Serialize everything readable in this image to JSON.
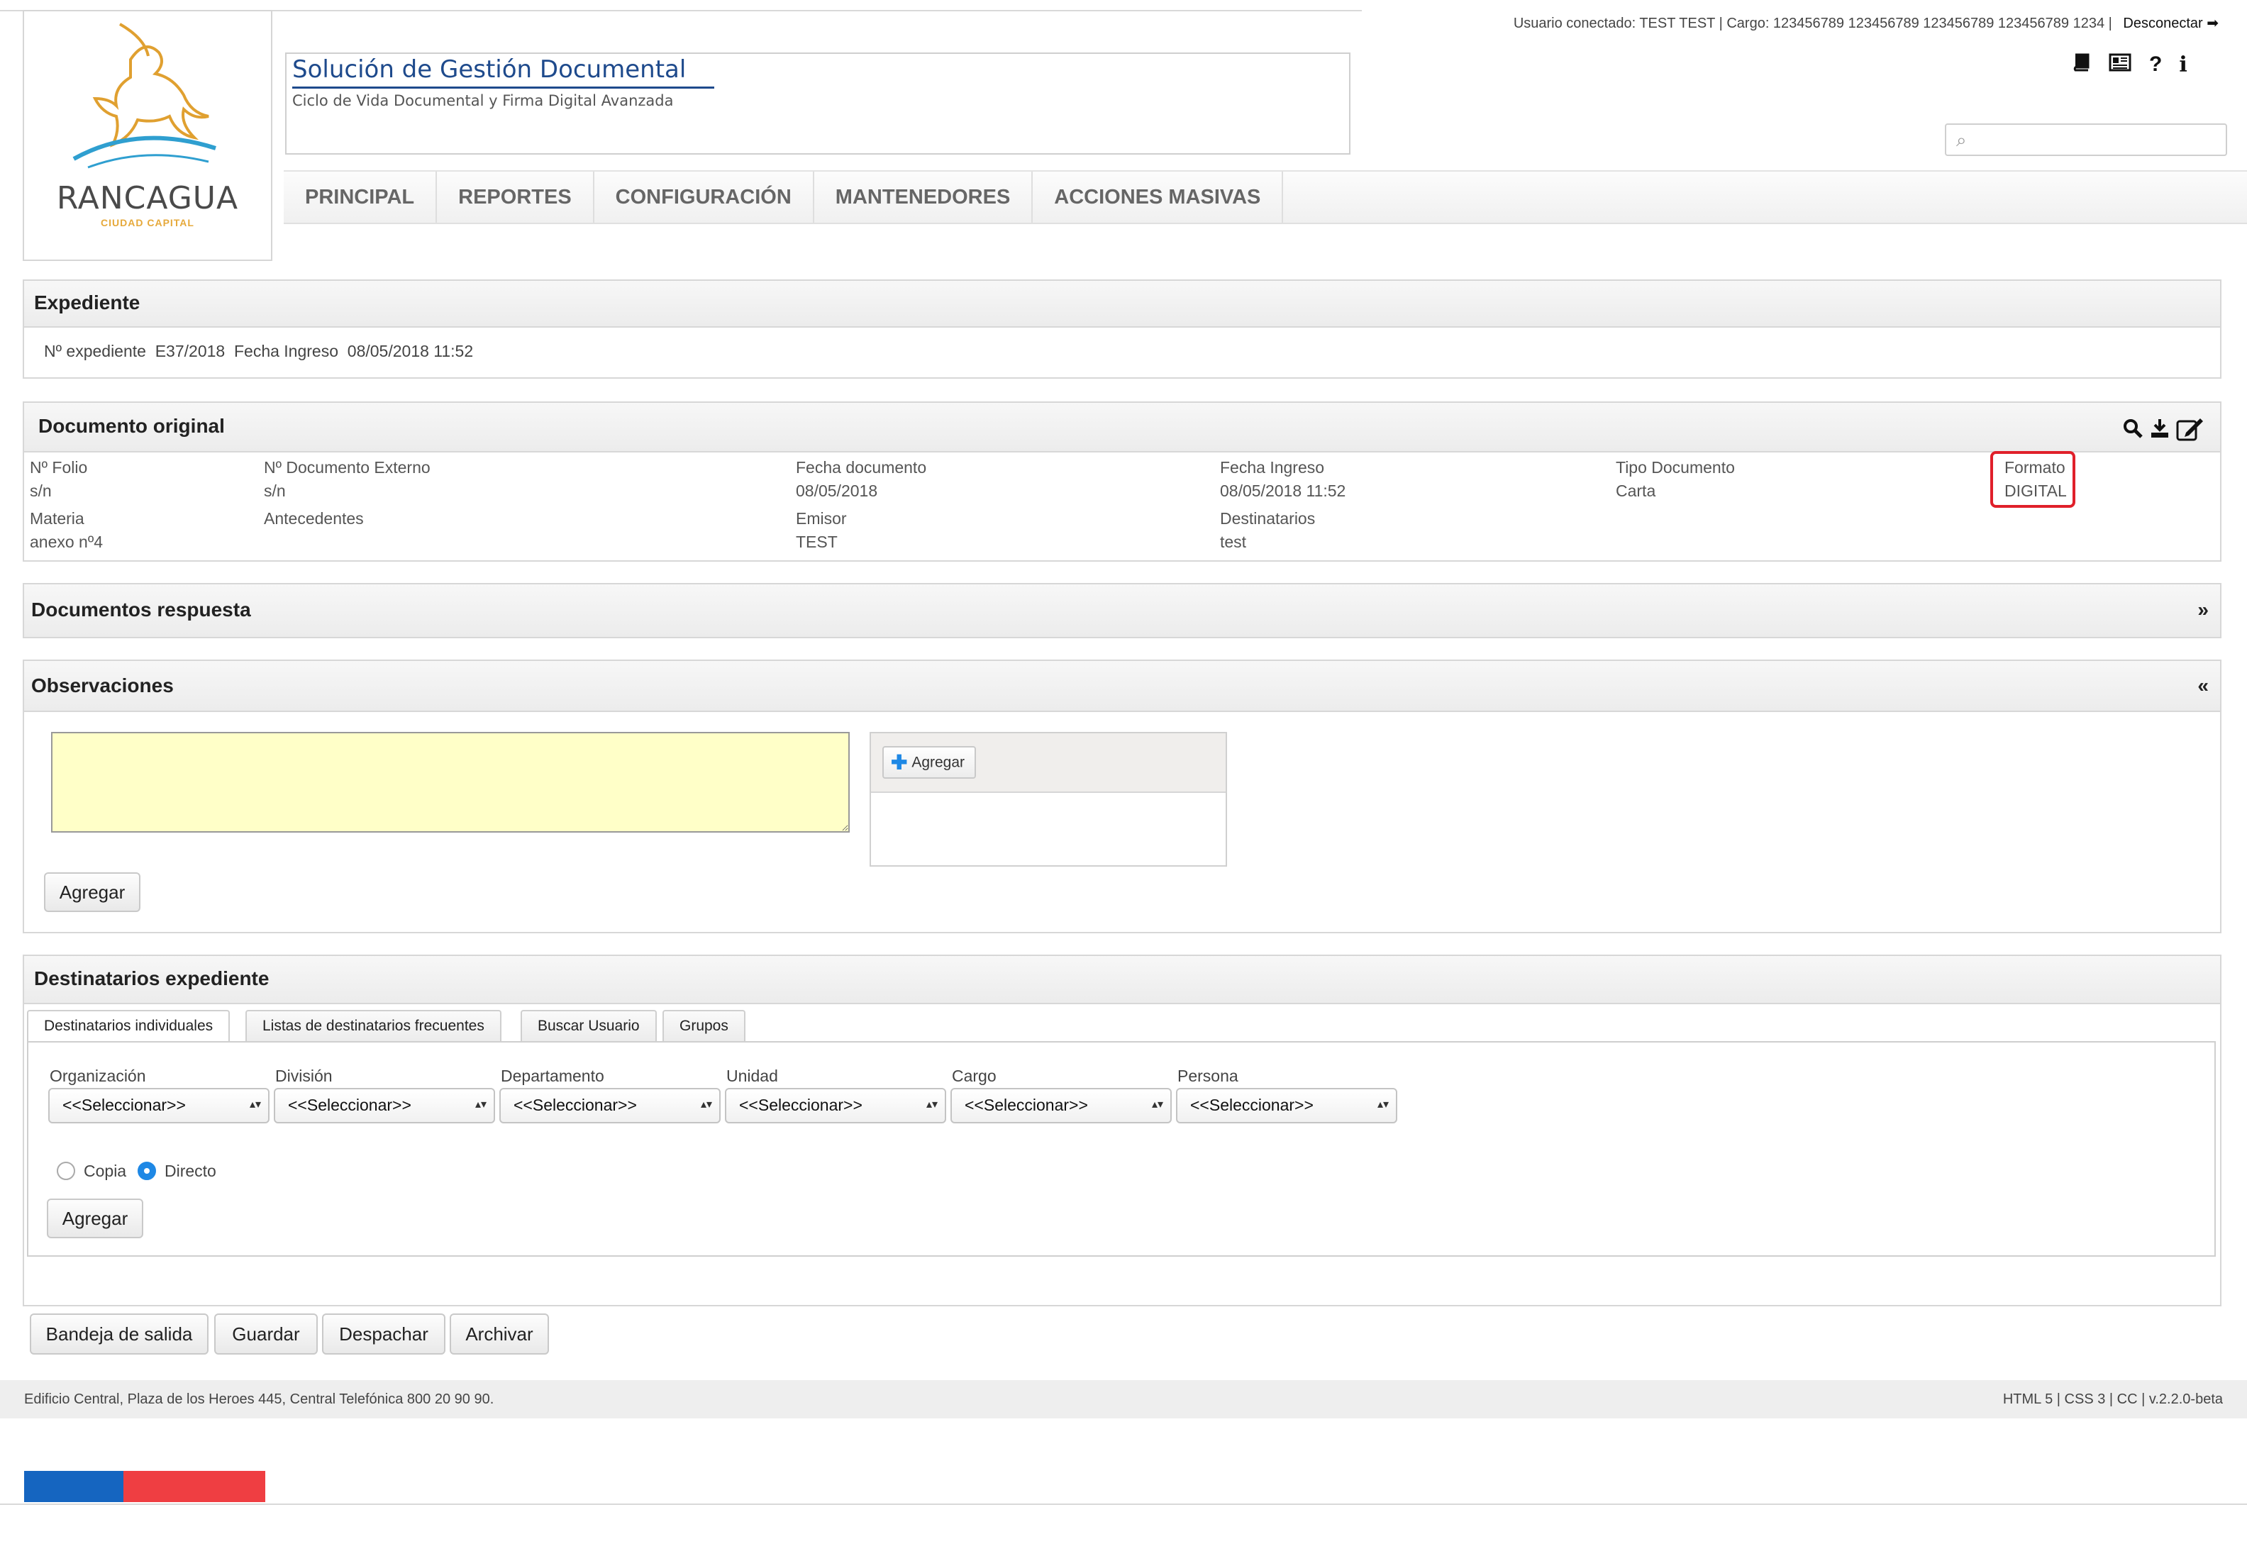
{
  "header": {
    "user_info": "Usuario conectado: TEST TEST | Cargo: 123456789 123456789 123456789 123456789 1234 |",
    "logout_label": "Desconectar",
    "logo_text": "RANCAGUA",
    "logo_subtext": "CIUDAD CAPITAL",
    "app_title": "Solución de Gestión Documental",
    "app_subtitle": "Ciclo de Vida Documental y Firma Digital Avanzada",
    "icons": [
      "book-icon",
      "newspaper-icon",
      "help-icon",
      "info-icon"
    ],
    "search_placeholder": ""
  },
  "nav": {
    "items": [
      "PRINCIPAL",
      "REPORTES",
      "CONFIGURACIÓN",
      "MANTENEDORES",
      "ACCIONES MASIVAS"
    ]
  },
  "expediente": {
    "title": "Expediente",
    "line": "Nº expediente  E37/2018  Fecha Ingreso  08/05/2018 11:52"
  },
  "documento_original": {
    "title": "Documento original",
    "fields": [
      {
        "label": "Nº Folio",
        "value": "s/n"
      },
      {
        "label": "Nº Documento Externo",
        "value": "s/n"
      },
      {
        "label": "Fecha documento",
        "value": "08/05/2018"
      },
      {
        "label": "Fecha Ingreso",
        "value": "08/05/2018 11:52"
      },
      {
        "label": "Tipo Documento",
        "value": "Carta"
      },
      {
        "label": "Formato",
        "value": "DIGITAL"
      },
      {
        "label": "Materia",
        "value": "anexo nº4"
      },
      {
        "label": "Antecedentes",
        "value": ""
      },
      {
        "label": "Emisor",
        "value": "TEST"
      },
      {
        "label": "Destinatarios",
        "value": "test"
      }
    ]
  },
  "documentos_respuesta": {
    "title": "Documentos respuesta",
    "toggle": "»"
  },
  "observaciones": {
    "title": "Observaciones",
    "toggle": "«",
    "textarea_value": "",
    "add_attachment_label": "Agregar",
    "add_button": "Agregar"
  },
  "destinatarios": {
    "title": "Destinatarios expediente",
    "tabs": [
      "Destinatarios individuales",
      "Listas de destinatarios frecuentes",
      "Buscar Usuario",
      "Grupos"
    ],
    "active_tab": 0,
    "selects": [
      {
        "label": "Organización",
        "value": "<<Seleccionar>>"
      },
      {
        "label": "División",
        "value": "<<Seleccionar>>"
      },
      {
        "label": "Departamento",
        "value": "<<Seleccionar>>"
      },
      {
        "label": "Unidad",
        "value": "<<Seleccionar>>"
      },
      {
        "label": "Cargo",
        "value": "<<Seleccionar>>"
      },
      {
        "label": "Persona",
        "value": "<<Seleccionar>>"
      }
    ],
    "radio_copia": "Copia",
    "radio_directo": "Directo",
    "selected_radio": "Directo",
    "add_button": "Agregar"
  },
  "actions": [
    "Bandeja de salida",
    "Guardar",
    "Despachar",
    "Archivar"
  ],
  "footer": {
    "address": "Edificio Central, Plaza de los Heroes 445, Central Telefónica 800 20 90 90.",
    "tech": "HTML 5 | CSS 3 | CC | v.2.2.0-beta"
  },
  "colors": {
    "accent": "#1e4a8c",
    "highlight_border": "#e0202a",
    "textarea_bg": "#ffffc8",
    "radio_selected": "#1e88e5",
    "flag_blue": "#1565c0",
    "flag_red": "#ef3e42"
  }
}
